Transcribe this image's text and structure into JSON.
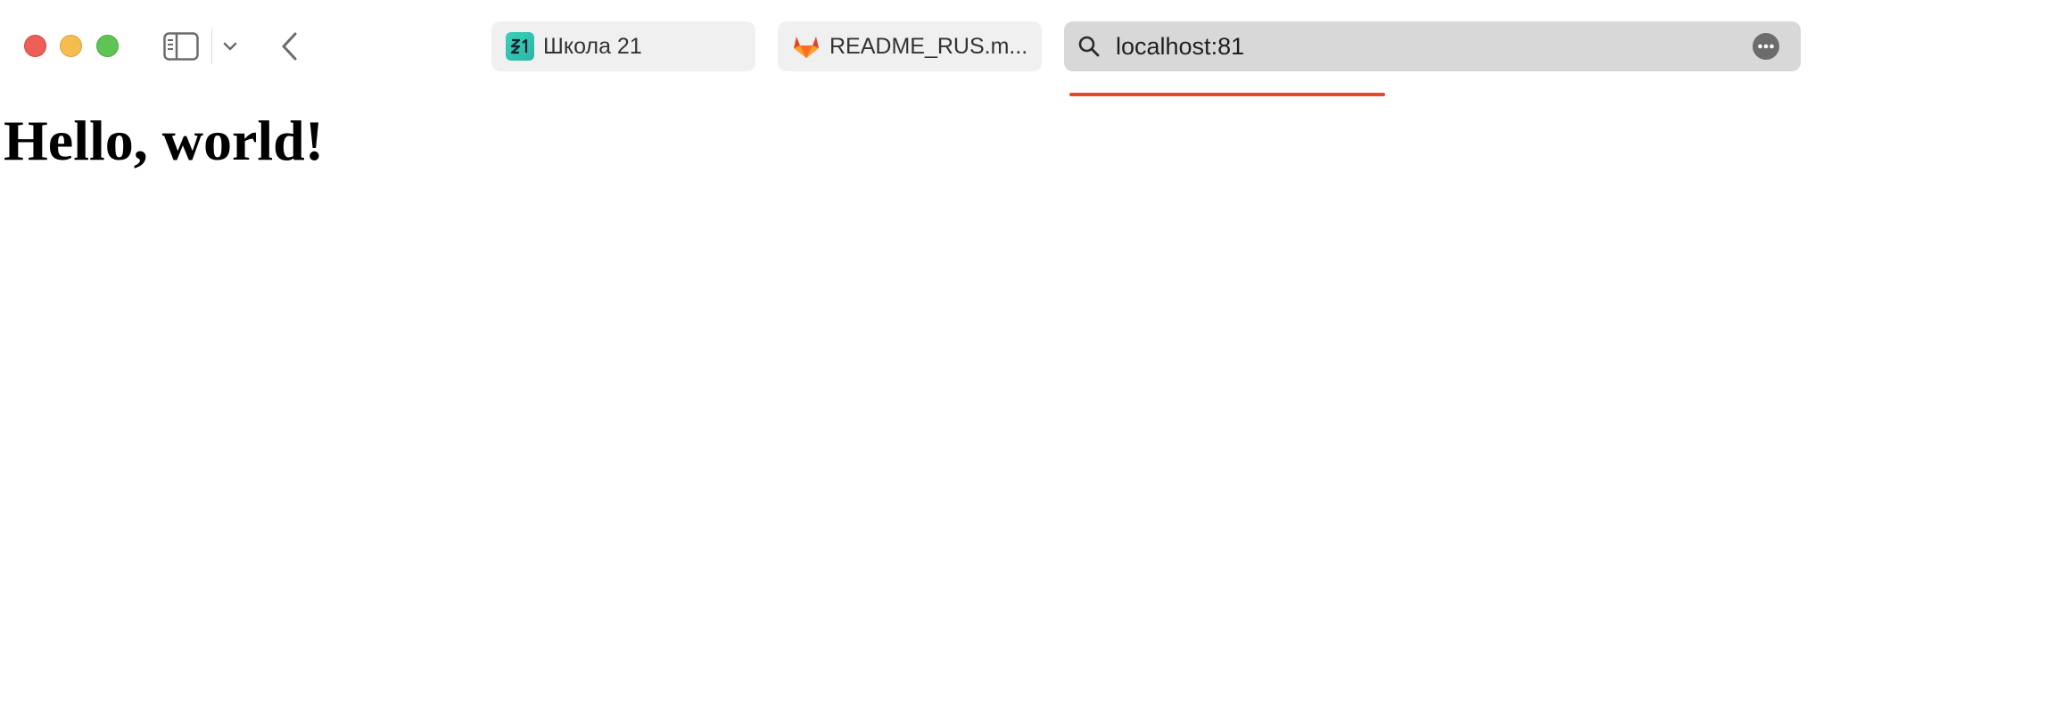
{
  "window": {
    "traffic_lights": [
      "close",
      "minimize",
      "maximize"
    ],
    "colors": {
      "close": "#ee5f57",
      "minimize": "#f5bd4f",
      "maximize": "#60c454"
    }
  },
  "toolbar": {
    "icons": [
      "sidebar-icon",
      "chevron-down-icon",
      "back-icon"
    ]
  },
  "tabs": [
    {
      "label": "Школа 21",
      "icon": "school21-icon"
    },
    {
      "label": "README_RUS.m...",
      "icon": "gitlab-icon"
    }
  ],
  "address_bar": {
    "url": "localhost:81",
    "icon": "search-icon",
    "more_icon": "more-icon"
  },
  "loading": {
    "visible": true,
    "color": "#e9472b"
  },
  "page": {
    "heading": "Hello, world!"
  }
}
